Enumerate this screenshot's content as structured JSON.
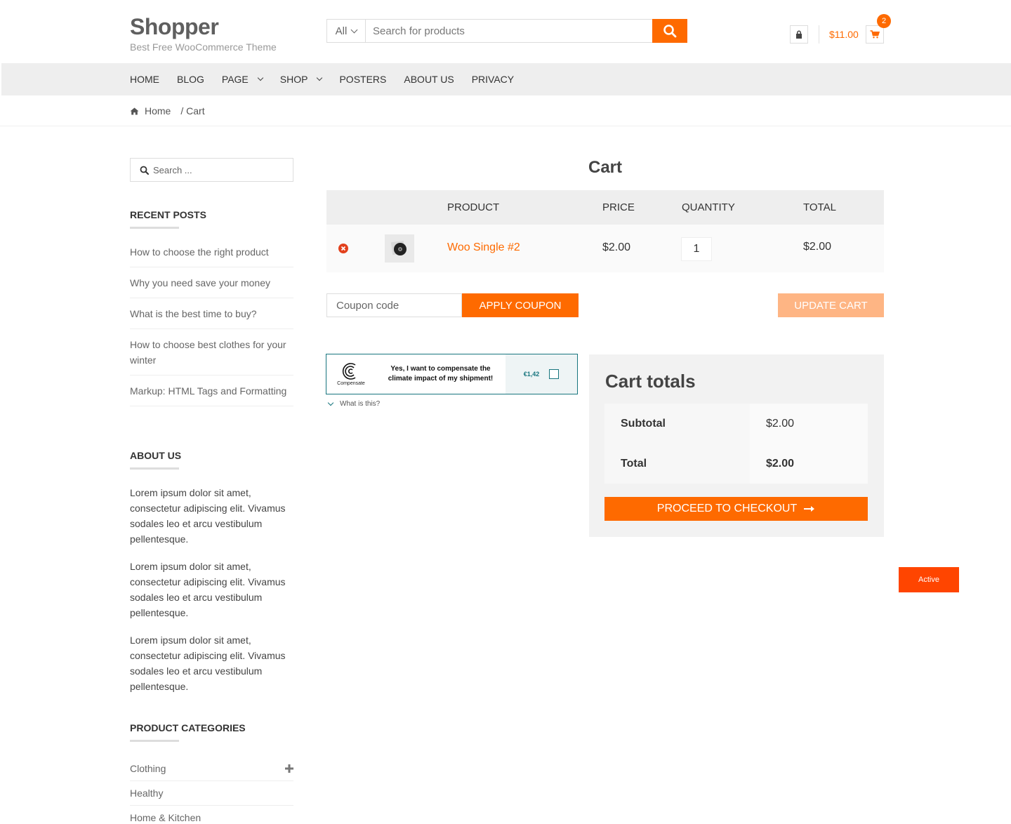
{
  "site": {
    "title": "Shopper",
    "tagline": "Best Free WooCommerce Theme"
  },
  "header_search": {
    "category": "All",
    "placeholder": "Search for products"
  },
  "header_cart": {
    "amount": "$11.00",
    "count": "2"
  },
  "nav": {
    "items": [
      "HOME",
      "BLOG",
      "PAGE",
      "SHOP",
      "POSTERS",
      "ABOUT US",
      "PRIVACY"
    ]
  },
  "breadcrumb": {
    "home": "Home",
    "current": "/ Cart"
  },
  "sidebar": {
    "search_placeholder": "Search ...",
    "recent_posts_title": "RECENT POSTS",
    "recent_posts": [
      "How to choose the right product",
      "Why you need save your money",
      "What is the best time to buy?",
      "How to choose best clothes for your winter",
      "Markup: HTML Tags and Formatting"
    ],
    "about_title": "ABOUT US",
    "about_paragraphs": [
      "Lorem ipsum dolor sit amet, consectetur adipiscing elit. Vivamus sodales leo et arcu vestibulum pellentesque.",
      "Lorem ipsum dolor sit amet, consectetur adipiscing elit. Vivamus sodales leo et arcu vestibulum pellentesque.",
      "Lorem ipsum dolor sit amet, consectetur adipiscing elit. Vivamus sodales leo et arcu vestibulum pellentesque."
    ],
    "categories_title": "PRODUCT CATEGORIES",
    "categories": [
      "Clothing",
      "Healthy",
      "Home & Kitchen"
    ]
  },
  "cart": {
    "title": "Cart",
    "headers": {
      "product": "PRODUCT",
      "price": "PRICE",
      "quantity": "QUANTITY",
      "total": "TOTAL"
    },
    "items": [
      {
        "name": "Woo Single #2",
        "price": "$2.00",
        "quantity": "1",
        "total": "$2.00"
      }
    ],
    "coupon_placeholder": "Coupon code",
    "apply_coupon": "APPLY COUPON",
    "update_cart": "UPDATE CART"
  },
  "compensate": {
    "logo_text": "Compensate",
    "message": "Yes, I want to compensate the climate impact of my shipment!",
    "price": "€1,42",
    "what_is_this": "What is this?"
  },
  "totals": {
    "title": "Cart totals",
    "subtotal_label": "Subtotal",
    "subtotal_value": "$2.00",
    "total_label": "Total",
    "total_value": "$2.00",
    "checkout": "PROCEED TO CHECKOUT"
  },
  "status_badge": "Active",
  "colors": {
    "accent": "#fe6a00",
    "accent_light": "#feb584",
    "remove": "#e2401c",
    "compensate_teal": "#17757e",
    "badge": "#ff4500"
  }
}
